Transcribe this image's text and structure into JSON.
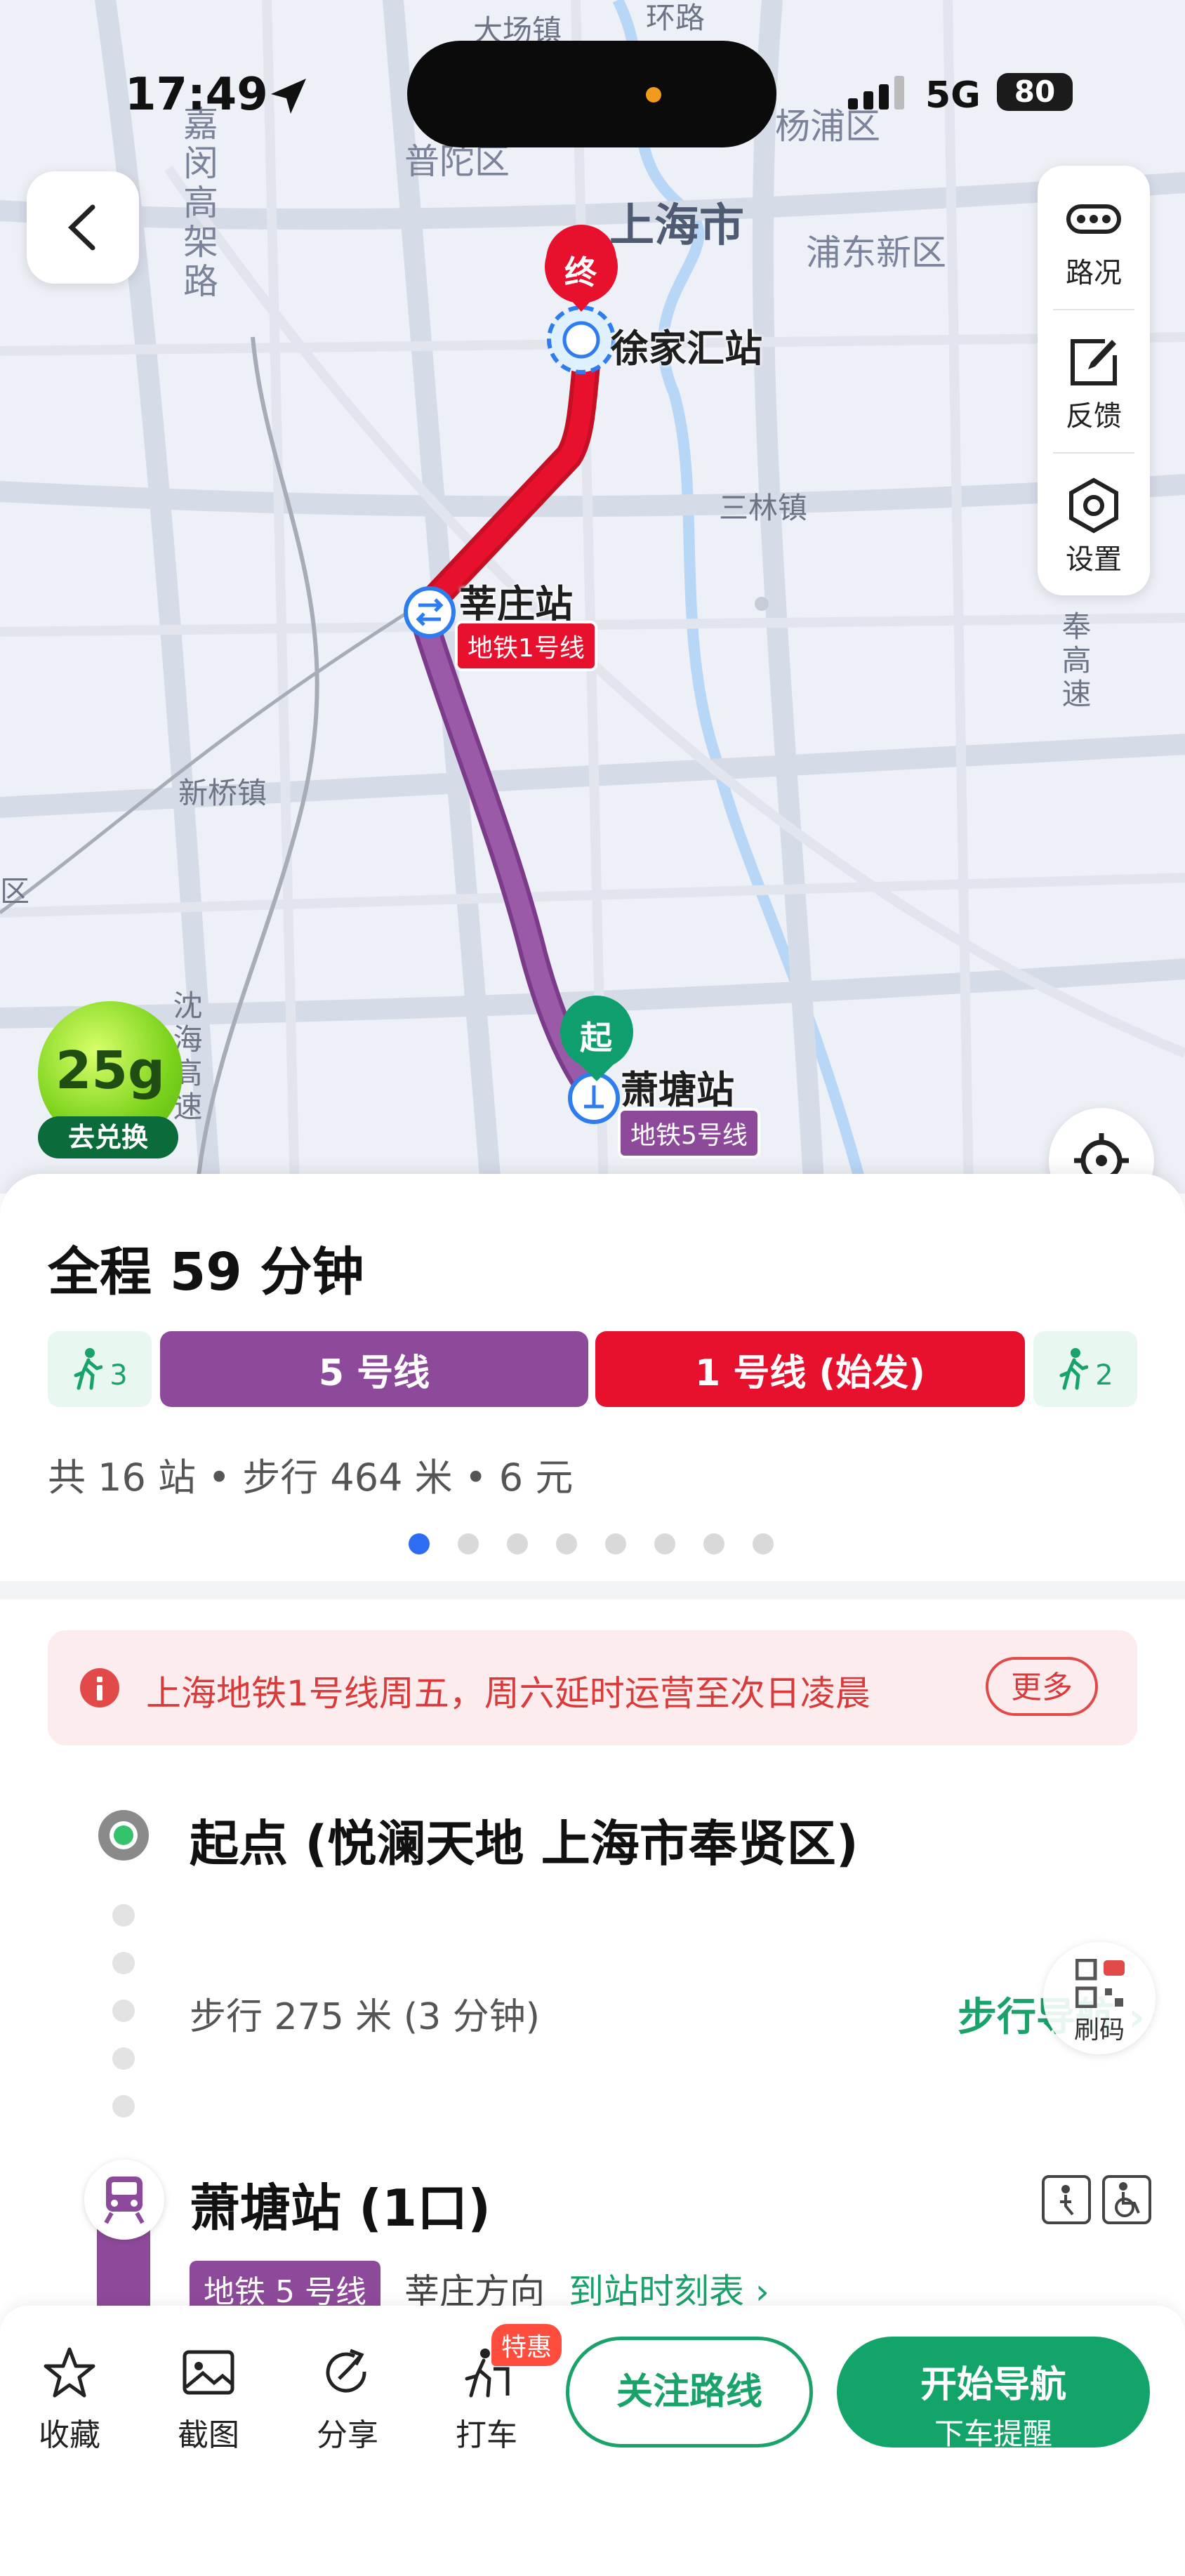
{
  "status": {
    "time": "17:49",
    "network": "5G",
    "battery": "80"
  },
  "map": {
    "labels": {
      "dachang": "大场镇",
      "huanlu": "环路",
      "yangpu": "杨浦区",
      "putuo": "普陀区",
      "shanghai": "上海市",
      "pudong": "浦东新区",
      "jiamin": "嘉闵高架路",
      "sanlin": "三林镇",
      "xinqiao": "新桥镇",
      "feng": "奉高速",
      "qu": "区",
      "shen": "沈海高速"
    },
    "stations": {
      "end": {
        "badge": "终",
        "name": "徐家汇站"
      },
      "transfer": {
        "name": "莘庄站",
        "tag": "地铁1号线"
      },
      "start": {
        "badge": "起",
        "name": "萧塘站",
        "tag": "地铁5号线"
      }
    }
  },
  "tools": [
    {
      "label": "路况",
      "icon": "traffic-icon"
    },
    {
      "label": "反馈",
      "icon": "feedback-icon"
    },
    {
      "label": "设置",
      "icon": "settings-icon"
    }
  ],
  "credits": {
    "value": "25g",
    "button": "去兑换"
  },
  "route": {
    "total": "全程 59 分钟",
    "segments": {
      "walk_start": "3",
      "line5": "5 号线",
      "line1": "1 号线 (始发)",
      "walk_end": "2"
    },
    "meta": "共 16 站 • 步行 464 米 • 6 元",
    "page_count": 8,
    "active_page": 1
  },
  "alert": {
    "text": "上海地铁1号线周五，周六延时运营至次日凌晨",
    "more": "更多"
  },
  "steps": {
    "start": "起点 (悦澜天地 上海市奉贤区)",
    "walk": "步行 275 米 (3 分钟)",
    "walk_nav": "步行导航 ›",
    "qr_label": "刷码",
    "station": "萧塘站 (1口)",
    "line_tag": "地铁 5 号线",
    "direction": "莘庄方向",
    "timetable": "到站时刻表 ›"
  },
  "bottom": {
    "favorite": "收藏",
    "screenshot": "截图",
    "share": "分享",
    "taxi": "打车",
    "taxi_badge": "特惠",
    "follow": "关注路线",
    "nav_main": "开始导航",
    "nav_sub": "下车提醒"
  },
  "colors": {
    "line1": "#e8112d",
    "line5": "#8e4a9a",
    "green": "#12a469"
  }
}
